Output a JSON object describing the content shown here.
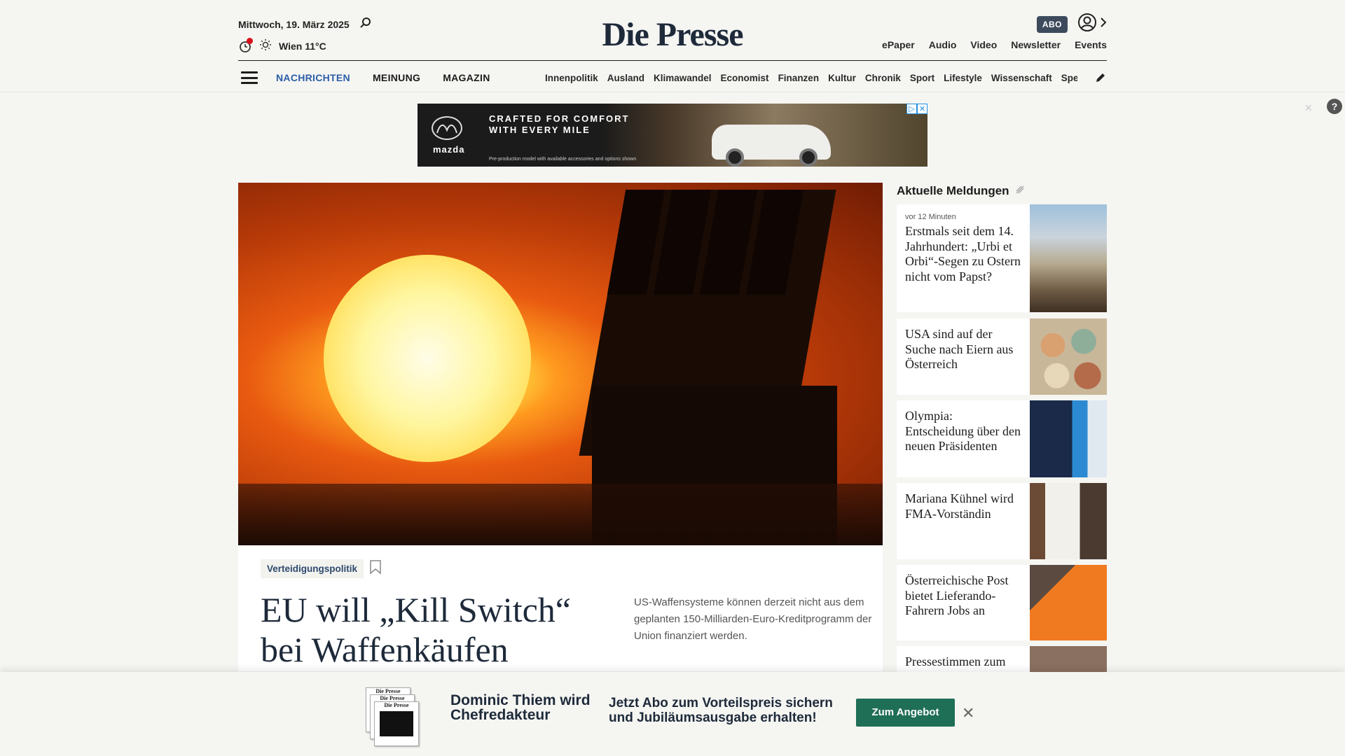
{
  "header": {
    "date": "Mittwoch, 19. März 2025",
    "weather": "Wien 11°C",
    "logo": "Die Presse",
    "abo_label": "ABO",
    "service_links": [
      "ePaper",
      "Audio",
      "Video",
      "Newsletter",
      "Events"
    ],
    "main_nav": [
      {
        "label": "NACHRICHTEN",
        "active": true
      },
      {
        "label": "MEINUNG",
        "active": false
      },
      {
        "label": "MAGAZIN",
        "active": false
      }
    ],
    "sub_nav": [
      "Innenpolitik",
      "Ausland",
      "Klimawandel",
      "Economist",
      "Finanzen",
      "Kultur",
      "Chronik",
      "Sport",
      "Lifestyle",
      "Wissenschaft",
      "Spectrum"
    ]
  },
  "ad": {
    "brand": "mazda",
    "text": "CRAFTED FOR COMFORT WITH EVERY MILE",
    "fine_print": "Pre-production model with available accessories and options shown"
  },
  "hero": {
    "tag": "Verteidigungspolitik",
    "headline": "EU will „Kill Switch“ bei Waffenkäufen",
    "teaser": "US-Waffensysteme können derzeit nicht aus dem geplanten 150-Milliarden-Euro-Kreditprogramm der Union finanziert werden."
  },
  "sidebar": {
    "title": "Aktuelle Meldungen",
    "items": [
      {
        "time": "vor 12 Minuten",
        "title": "Erstmals seit dem 14. Jahrhundert: „Urbi et Orbi“-Segen zu Ostern nicht vom Papst?"
      },
      {
        "time": "",
        "title": "USA sind auf der Suche nach Eiern aus Österreich"
      },
      {
        "time": "",
        "title": "Olympia: Entscheidung über den neuen Präsidenten"
      },
      {
        "time": "",
        "title": "Mariana Kühnel wird FMA-Vorständin"
      },
      {
        "time": "",
        "title": "Österreichische Post bietet Lieferando-Fahrern Jobs an"
      },
      {
        "time": "",
        "title": "Pressestimmen zum"
      }
    ]
  },
  "banner": {
    "promo1": "Dominic Thiem wird Chefredakteur",
    "promo2": "Jetzt Abo zum Vorteilspreis sichern und Jubiläumsausgabe erhalten!",
    "cta": "Zum Angebot",
    "paper_mini": "Die Presse"
  },
  "colors": {
    "accent_blue": "#2b5ea7",
    "cta_green": "#1f6e56",
    "logo_navy": "#1e2a3a"
  }
}
